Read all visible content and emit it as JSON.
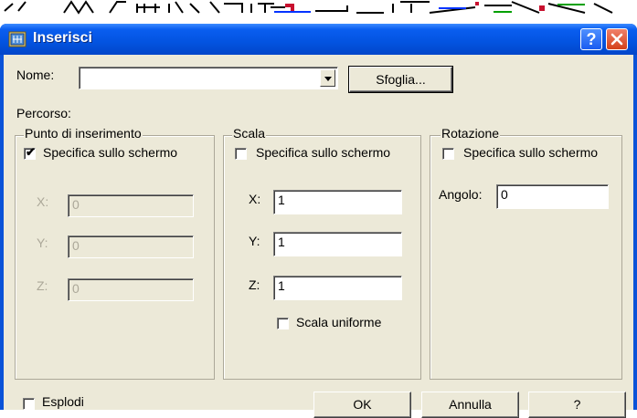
{
  "window": {
    "title": "Inserisci",
    "help_button": "?",
    "close_button": "✕"
  },
  "name_row": {
    "label": "Nome:",
    "value": "",
    "browse_label": "Sfoglia..."
  },
  "path": {
    "label": "Percorso:"
  },
  "insertion_point": {
    "title": "Punto di inserimento",
    "specify_on_screen": {
      "label": "Specifica sullo schermo",
      "checked": true
    },
    "x": {
      "label": "X:",
      "value": "0"
    },
    "y": {
      "label": "Y:",
      "value": "0"
    },
    "z": {
      "label": "Z:",
      "value": "0"
    }
  },
  "scale": {
    "title": "Scala",
    "specify_on_screen": {
      "label": "Specifica sullo schermo",
      "checked": false
    },
    "x": {
      "label": "X:",
      "value": "1"
    },
    "y": {
      "label": "Y:",
      "value": "1"
    },
    "z": {
      "label": "Z:",
      "value": "1"
    },
    "uniform": {
      "label": "Scala uniforme",
      "checked": false
    }
  },
  "rotation": {
    "title": "Rotazione",
    "specify_on_screen": {
      "label": "Specifica sullo schermo",
      "checked": false
    },
    "angle": {
      "label": "Angolo:",
      "value": "0"
    }
  },
  "explode": {
    "label": "Esplodi",
    "checked": false
  },
  "buttons": {
    "ok": "OK",
    "cancel": "Annulla",
    "help": "?"
  },
  "colors": {
    "titlebar": "#0353e0",
    "face": "#ece9d8",
    "disabled_text": "#aca899"
  },
  "icons": {
    "title": "block-insert-icon",
    "combo": "chevron-down-icon"
  }
}
